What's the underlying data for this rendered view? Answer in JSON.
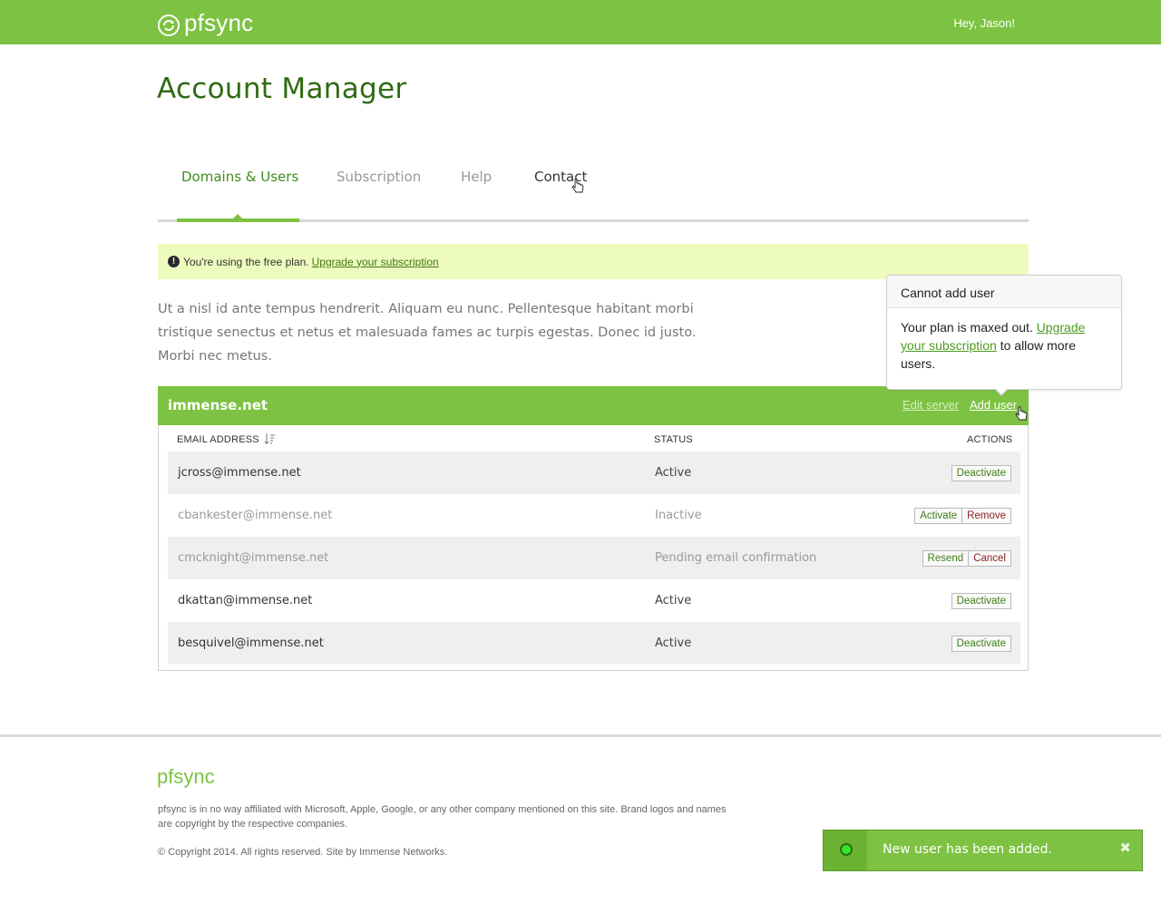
{
  "header": {
    "brand": "pfsync",
    "greeting": "Hey, Jason!"
  },
  "page": {
    "title": "Account Manager"
  },
  "tabs": [
    {
      "label": "Domains & Users",
      "active": true
    },
    {
      "label": "Subscription",
      "active": false
    },
    {
      "label": "Help",
      "active": false
    },
    {
      "label": "Contact",
      "active": false
    }
  ],
  "notice": {
    "text": "You're using the free plan.",
    "link": "Upgrade your subscription"
  },
  "intro": "Ut a nisl id ante tempus hendrerit. Aliquam eu nunc. Pellentesque habitant morbi tristique senectus et netus et malesuada fames ac turpis egestas. Donec id justo. Morbi nec metus.",
  "domain": {
    "name": "immense.net",
    "edit_server": "Edit server",
    "add_user": "Add user",
    "columns": {
      "email": "EMAIL ADDRESS",
      "status": "STATUS",
      "actions": "ACTIONS"
    },
    "users": [
      {
        "email": "jcross@immense.net",
        "status": "Active",
        "actions": [
          {
            "label": "Deactivate",
            "tone": "green"
          }
        ]
      },
      {
        "email": "cbankester@immense.net",
        "status": "Inactive",
        "actions": [
          {
            "label": "Activate",
            "tone": "green"
          },
          {
            "label": "Remove",
            "tone": "red"
          }
        ]
      },
      {
        "email": "cmcknight@immense.net",
        "status": "Pending email confirmation",
        "actions": [
          {
            "label": "Resend",
            "tone": "green"
          },
          {
            "label": "Cancel",
            "tone": "red"
          }
        ]
      },
      {
        "email": "dkattan@immense.net",
        "status": "Active",
        "actions": [
          {
            "label": "Deactivate",
            "tone": "green"
          }
        ]
      },
      {
        "email": "besquivel@immense.net",
        "status": "Active",
        "actions": [
          {
            "label": "Deactivate",
            "tone": "green"
          }
        ]
      }
    ]
  },
  "popover": {
    "title": "Cannot add user",
    "body_prefix": "Your plan is maxed out.",
    "link": "Upgrade your subscription",
    "body_suffix": "to allow more users."
  },
  "footer": {
    "brand": "pfsync",
    "disclaimer": "pfsync is in no way affiliated with Microsoft, Apple, Google, or any other company mentioned on this site. Brand logos and names are copyright by the respective companies.",
    "copyright": "© Copyright 2014. All rights reserved. Site by Immense Networks."
  },
  "toast": {
    "message": "New user has been added.",
    "close": "✖"
  },
  "colors": {
    "brand_green": "#7dc242",
    "title_green": "#2f6b12",
    "notice_bg": "#eefbbe",
    "deactivate": "#3e7d17",
    "remove": "#8a1f1f"
  }
}
